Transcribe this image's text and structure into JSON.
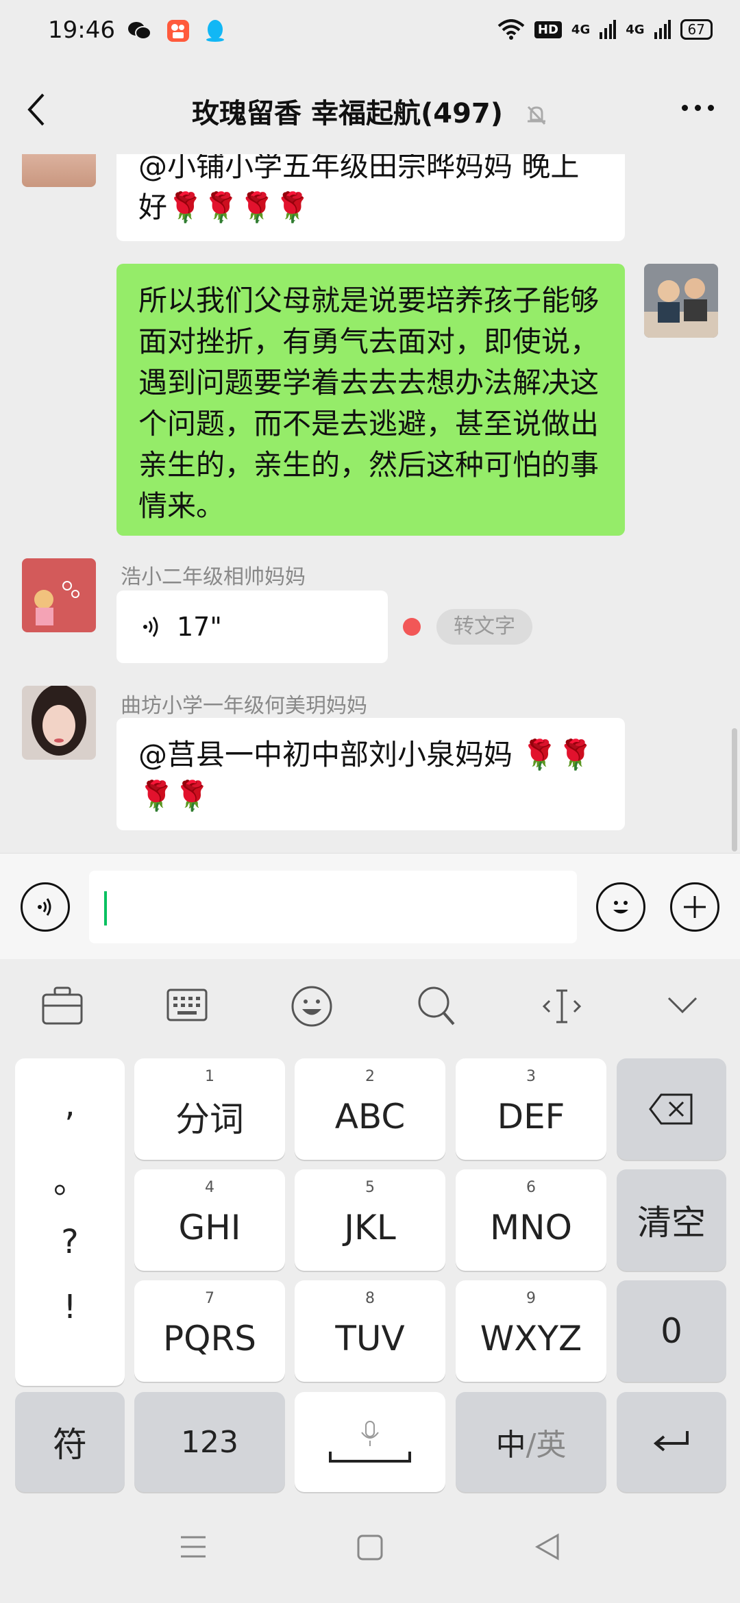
{
  "status": {
    "time": "19:46",
    "hd": "HD",
    "net1": "4G",
    "net2": "4G",
    "battery": "67"
  },
  "header": {
    "title": "玫瑰留香  幸福起航(497)"
  },
  "messages": {
    "m1_text": "@小铺小学五年级田宗晔妈妈  晚上好🌹🌹🌹🌹",
    "m2_text": "所以我们父母就是说要培养孩子能够面对挫折，有勇气去面对，即使说，遇到问题要学着去去去想办法解决这个问题，而不是去逃避，甚至说做出亲生的，亲生的，然后这种可怕的事情来。",
    "m3_sender": "浩小二年级相帅妈妈",
    "m3_voice": "17\"",
    "m3_convert": "转文字",
    "m4_sender": "曲坊小学一年级何美玥妈妈",
    "m4_text": "@莒县一中初中部刘小泉妈妈 🌹🌹🌹🌹"
  },
  "keyboard": {
    "punct": [
      ",",
      "。",
      "?",
      "!"
    ],
    "keys": [
      {
        "num": "1",
        "label": "分词"
      },
      {
        "num": "2",
        "label": "ABC"
      },
      {
        "num": "3",
        "label": "DEF"
      },
      {
        "num": "4",
        "label": "GHI"
      },
      {
        "num": "5",
        "label": "JKL"
      },
      {
        "num": "6",
        "label": "MNO"
      },
      {
        "num": "7",
        "label": "PQRS"
      },
      {
        "num": "8",
        "label": "TUV"
      },
      {
        "num": "9",
        "label": "WXYZ"
      }
    ],
    "clear": "清空",
    "zero": "0",
    "symbol": "符",
    "num123": "123",
    "lang_zh": "中",
    "lang_en": "英"
  }
}
